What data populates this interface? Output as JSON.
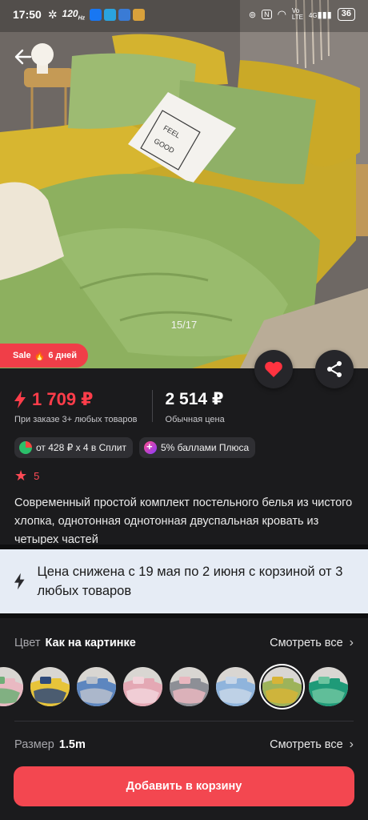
{
  "status_bar": {
    "time": "17:50",
    "refresh_rate": "120",
    "refresh_unit": "Hz",
    "network": "4G",
    "volte": "Vo LTE",
    "battery": "36"
  },
  "gallery": {
    "counter": "15/17",
    "sale_label": "Sale",
    "sale_days": "6 дней",
    "pillow_text_1": "FEEL",
    "pillow_text_2": "GOOD"
  },
  "price": {
    "current": "1 709 ₽",
    "current_note": "При заказе 3+ любых товаров",
    "regular": "2 514 ₽",
    "regular_note": "Обычная цена",
    "accent_color": "#ff3d4a"
  },
  "chips": [
    {
      "label": "от 428 ₽ x 4 в Сплит",
      "icon": "split-icon"
    },
    {
      "label": "5% баллами Плюса",
      "icon": "plus-points-icon"
    }
  ],
  "rating": {
    "value": "5"
  },
  "product_title": "Современный простой комплект постельного белья из чистого хлопка, однотонная однотонная двуспальная кровать из четырех частей",
  "promo": {
    "text": "Цена снижена с 19 мая по 2 июня с корзиной от 3 любых товаров"
  },
  "color": {
    "label": "Цвет",
    "value": "Как на картинке",
    "see_all": "Смотреть все",
    "swatches": [
      {
        "name": "pink-green",
        "colors": [
          "#e9b9c2",
          "#6fae77"
        ]
      },
      {
        "name": "yellow-navy",
        "colors": [
          "#e7c43a",
          "#2f4a7a"
        ]
      },
      {
        "name": "blue-gray",
        "colors": [
          "#5d86bf",
          "#b8c0cc"
        ]
      },
      {
        "name": "pink",
        "colors": [
          "#e4a8b4",
          "#f2d3da"
        ]
      },
      {
        "name": "gray-pink",
        "colors": [
          "#8d8f96",
          "#e9b7bf"
        ]
      },
      {
        "name": "light-blue",
        "colors": [
          "#8fb4dc",
          "#c7d6e8"
        ]
      },
      {
        "name": "green-yellow",
        "colors": [
          "#9db35a",
          "#d7b437"
        ],
        "selected": true
      },
      {
        "name": "green-teal",
        "colors": [
          "#1f9a78",
          "#6cc49f"
        ]
      }
    ]
  },
  "size": {
    "label": "Размер",
    "value": "1.5m",
    "see_all": "Смотреть все"
  },
  "cart_button": "Добавить в корзину"
}
